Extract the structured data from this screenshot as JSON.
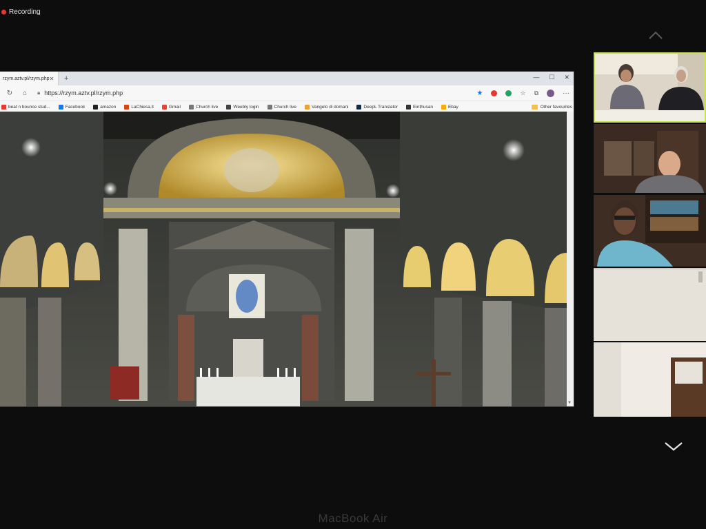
{
  "recording": {
    "label": "Recording"
  },
  "browser": {
    "tab_title": "rzym.aztv.pl/rzym.php",
    "url": "https://rzym.aztv.pl/rzym.php",
    "bookmarks": [
      {
        "label": "beat n bounce stud...",
        "color": "#e53935"
      },
      {
        "label": "Facebook",
        "color": "#1877f2"
      },
      {
        "label": "amazon",
        "color": "#222222"
      },
      {
        "label": "LaChiesa.it",
        "color": "#d84315"
      },
      {
        "label": "Gmail",
        "color": "#ea4335"
      },
      {
        "label": "Church live",
        "color": "#777777"
      },
      {
        "label": "Weebly login",
        "color": "#444444"
      },
      {
        "label": "Church live",
        "color": "#777777"
      },
      {
        "label": "Vangelo di domani",
        "color": "#e8a23a"
      },
      {
        "label": "DeepL Translator",
        "color": "#0f2b46"
      },
      {
        "label": "Einthusan",
        "color": "#333333"
      },
      {
        "label": "Ebay",
        "color": "#f5af02"
      }
    ],
    "other_favourites": "Other favourites"
  },
  "device": {
    "brand": "MacBook Air"
  }
}
